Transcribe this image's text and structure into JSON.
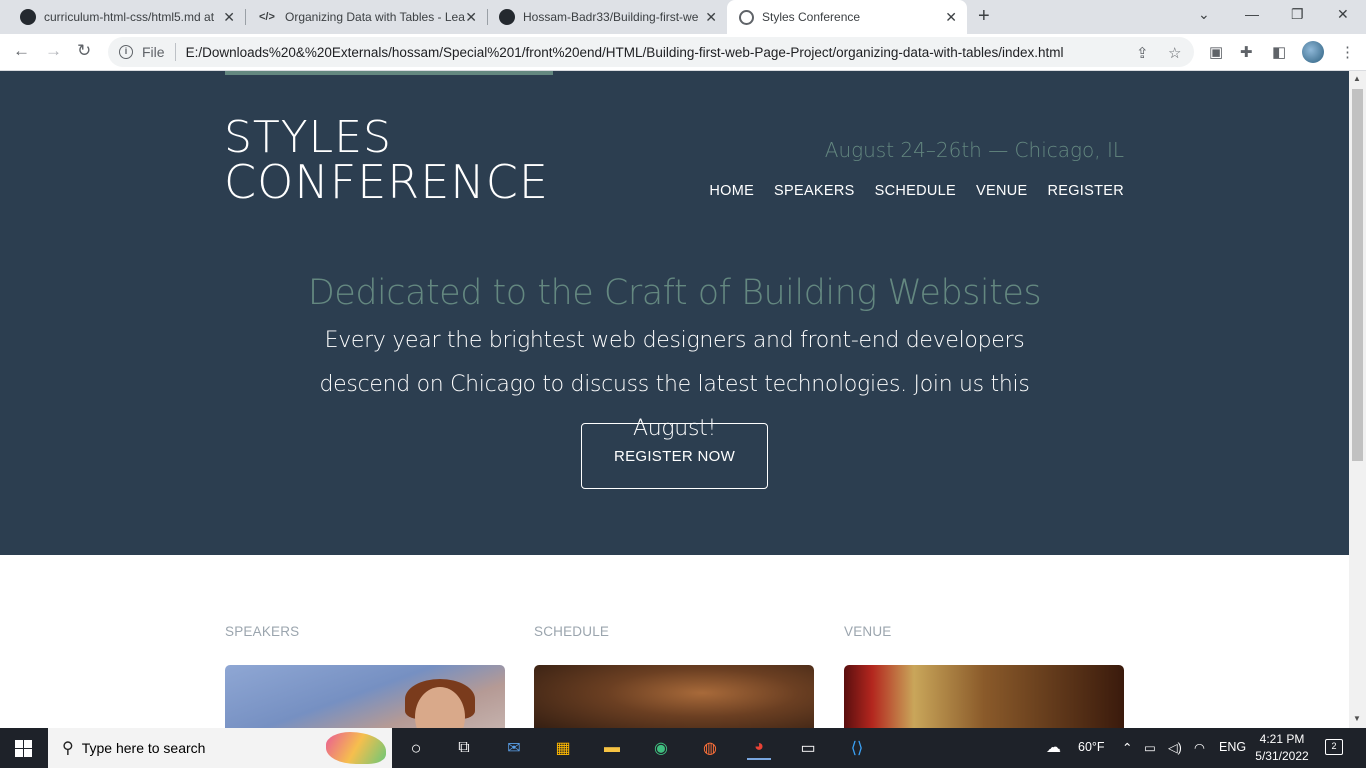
{
  "browser": {
    "tabs": [
      {
        "title": "curriculum-html-css/html5.md at",
        "icon": "github-icon"
      },
      {
        "title": "Organizing Data with Tables - Lea",
        "icon": "code-icon"
      },
      {
        "title": "Hossam-Badr33/Building-first-we",
        "icon": "github-icon"
      },
      {
        "title": "Styles Conference",
        "icon": "globe-icon"
      }
    ],
    "new_tab": "+",
    "omnibox": {
      "scheme_label": "File",
      "url": "E:/Downloads%20&%20Externals/hossam/Special%201/front%20end/HTML/Building-first-web-Page-Project/organizing-data-with-tables/index.html"
    }
  },
  "site": {
    "logo_line1": "STYLES",
    "logo_line2": "CONFERENCE",
    "dates": "August 24–26th — Chicago, IL",
    "nav": [
      "HOME",
      "SPEAKERS",
      "SCHEDULE",
      "VENUE",
      "REGISTER"
    ],
    "tagline": "Dedicated to the Craft of Building Websites",
    "blurb": "Every year the brightest web designers and front-end developers descend on Chicago to discuss the latest technologies. Join us this August!",
    "cta": "REGISTER NOW",
    "sections": [
      "SPEAKERS",
      "SCHEDULE",
      "VENUE"
    ],
    "colors": {
      "hero_bg": "#2c3e50",
      "accent": "#648880",
      "text": "#ffffff"
    }
  },
  "taskbar": {
    "search_placeholder": "Type here to search",
    "weather": "60°F",
    "language": "ENG",
    "time": "4:21 PM",
    "date": "5/31/2022",
    "notifications": "2"
  }
}
